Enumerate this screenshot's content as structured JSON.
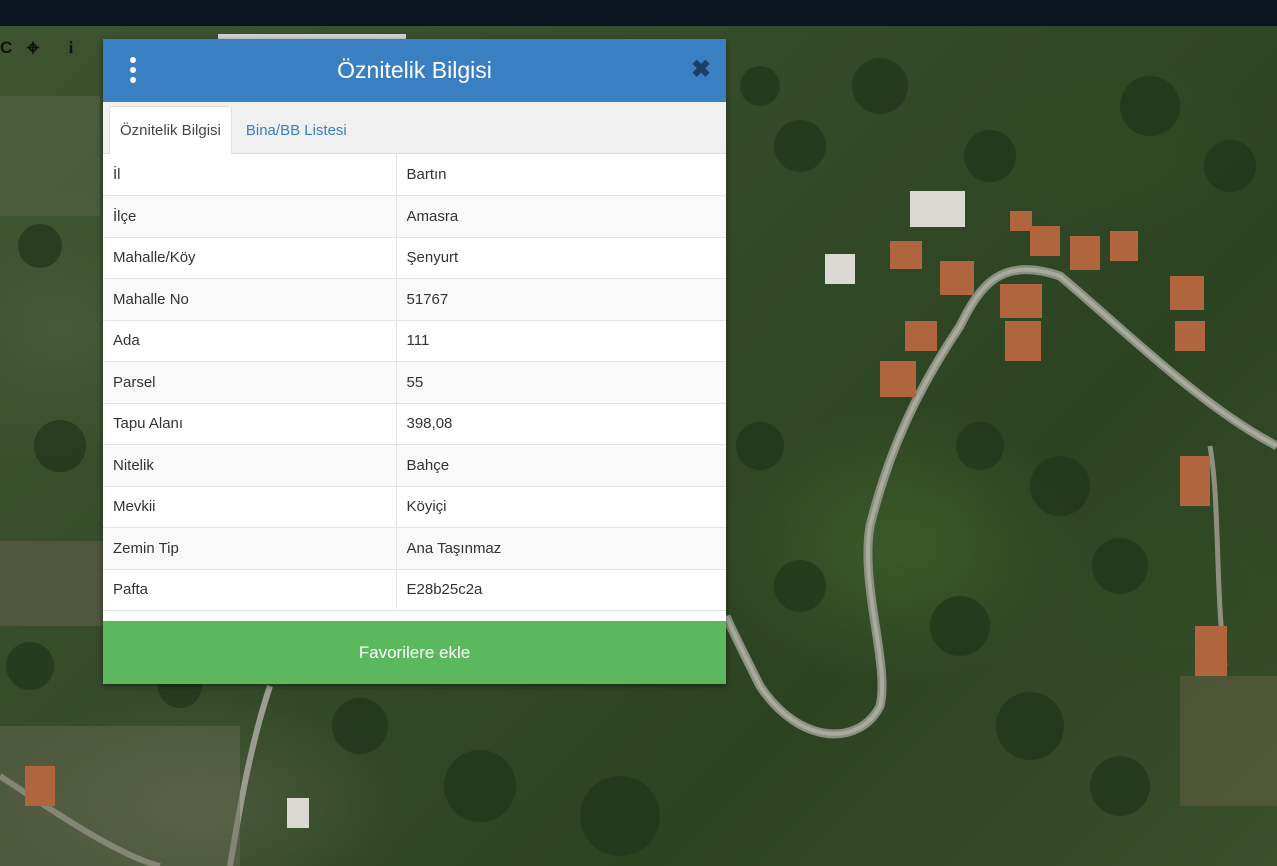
{
  "map_tools": [
    {
      "icon": "refresh-icon",
      "glyph": "C"
    },
    {
      "icon": "crosshair-icon",
      "glyph": "⌖"
    },
    {
      "icon": "info-icon",
      "glyph": "i"
    }
  ],
  "panel": {
    "title": "Öznitelik Bilgisi",
    "close_glyph": "✖",
    "tabs": [
      {
        "label": "Öznitelik Bilgisi",
        "active": true
      },
      {
        "label": "Bina/BB Listesi",
        "active": false
      }
    ],
    "rows": [
      {
        "key": "İl",
        "value": "Bartın"
      },
      {
        "key": "İlçe",
        "value": "Amasra"
      },
      {
        "key": "Mahalle/Köy",
        "value": "Şenyurt"
      },
      {
        "key": "Mahalle No",
        "value": "51767"
      },
      {
        "key": "Ada",
        "value": "111"
      },
      {
        "key": "Parsel",
        "value": "55"
      },
      {
        "key": "Tapu Alanı",
        "value": "398,08"
      },
      {
        "key": "Nitelik",
        "value": "Bahçe"
      },
      {
        "key": "Mevkii",
        "value": "Köyiçi"
      },
      {
        "key": "Zemin Tip",
        "value": "Ana Taşınmaz"
      },
      {
        "key": "Pafta",
        "value": "E28b25c2a"
      }
    ],
    "favorite_button": "Favorilere ekle"
  },
  "colors": {
    "header": "#3a7fc1",
    "favorite_button": "#5cb85c",
    "tab_link": "#3a7fc1"
  }
}
